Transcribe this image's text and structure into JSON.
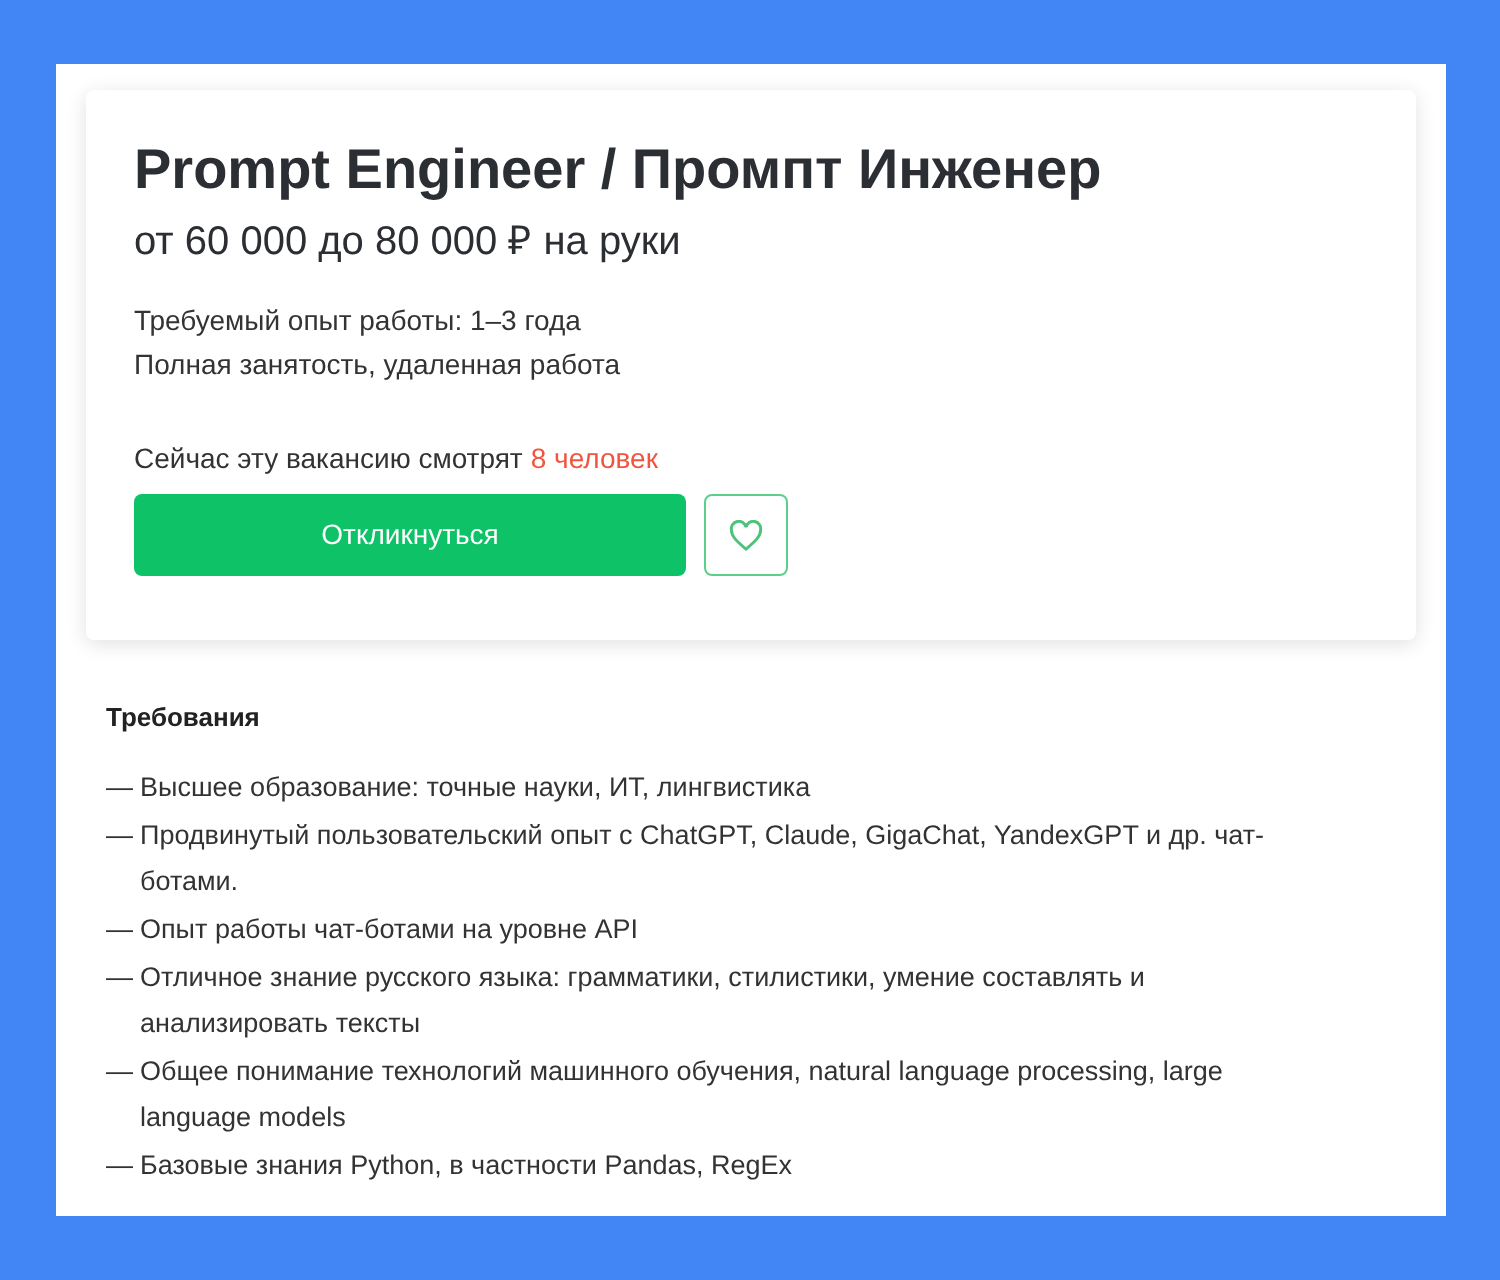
{
  "vacancy": {
    "title": "Prompt Engineer / Промпт Инженер",
    "salary": "от 60 000 до 80 000 ₽ на руки",
    "experience": "Требуемый опыт работы: 1–3 года",
    "employment": "Полная занятость, удаленная работа",
    "viewers_text": "Сейчас эту вакансию смотрят",
    "viewers_count": "8 человек",
    "apply_button": "Откликнуться",
    "favorite": false
  },
  "requirements": {
    "heading": "Требования",
    "items": [
      {
        "bullet": "—",
        "text": "Высшее образование: точные науки, ИТ, лингвистика"
      },
      {
        "bullet": "—",
        "text": "Продвинутый пользовательский опыт с ChatGPT, Claude, GigaChat, YandexGPT и др. чат-ботами."
      },
      {
        "bullet": "—",
        "text": "Опыт работы чат-ботами на уровне API"
      },
      {
        "bullet": "—",
        "text": "Отличное знание русского языка: грамматики, стилистики, умение составлять и анализировать тексты"
      },
      {
        "bullet": "—",
        "text": "Общее понимание технологий машинного обучения, natural language processing, large language models"
      },
      {
        "bullet": "—",
        "text": "Базовые знания Python, в частности Pandas, RegEx"
      }
    ]
  }
}
